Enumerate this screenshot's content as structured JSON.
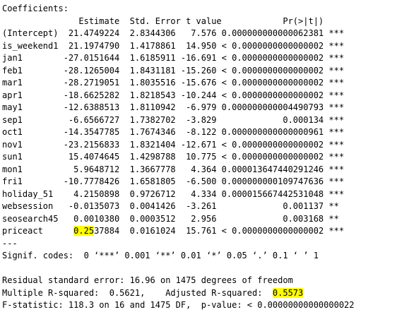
{
  "coefficients": {
    "heading": "Coefficients:",
    "header_line": "               Estimate  Std. Error t value            Pr(>|t|)    ",
    "rows": [
      {
        "pre": "(Intercept)  21.4749224  2.8344306   7.576 0.000000000000062381 ***"
      },
      {
        "pre": "is_weekend1  21.1974790  1.4178861  14.950 < 0.0000000000000002 ***"
      },
      {
        "pre": "jan1        -27.0151644  1.6185911 -16.691 < 0.0000000000000002 ***"
      },
      {
        "pre": "feb1        -28.1265004  1.8431181 -15.260 < 0.0000000000000002 ***"
      },
      {
        "pre": "mar1        -28.2719051  1.8035516 -15.676 < 0.0000000000000002 ***"
      },
      {
        "pre": "apr1        -18.6625282  1.8218543 -10.244 < 0.0000000000000002 ***"
      },
      {
        "pre": "may1        -12.6388513  1.8110942  -6.979 0.000000000004490793 ***"
      },
      {
        "pre": "sep1         -6.6566727  1.7382702  -3.829             0.000134 ***"
      },
      {
        "pre": "oct1        -14.3547785  1.7674346  -8.122 0.000000000000000961 ***"
      },
      {
        "pre": "nov1        -23.2156833  1.8321404 -12.671 < 0.0000000000000002 ***"
      },
      {
        "pre": "sun1         15.4074645  1.4298788  10.775 < 0.0000000000000002 ***"
      },
      {
        "pre": "mon1          5.9648712  1.3667778   4.364 0.00001364744029124­6 ***"
      },
      {
        "pre": "fri1        -10.7778426  1.6581805  -6.500 0.000000000109747636 ***"
      },
      {
        "pre": "holiday_51    4.2150898  0.9726712   4.334 0.000015667442531048 ***"
      },
      {
        "pre": "websession   -0.0135073  0.0041426  -3.261             0.001137 ** "
      },
      {
        "pre": "seosearch45   0.0010380  0.0003512   2.956             0.003168 ** "
      },
      {
        "pre": "priceact      ",
        "hl": "0.25",
        "post": "37884  0.0161024  15.761 < 0.0000000000000002 ***"
      }
    ],
    "separator": "---"
  },
  "signif": "Signif. codes:  0 ‘***’ 0.001 ‘**’ 0.01 ‘*’ 0.05 ‘.’ 0.1 ‘ ’ 1",
  "summary": {
    "rse": "Residual standard error: 16.96 on 1475 degrees of freedom",
    "r2_pre": "Multiple R-squared:  0.5621,\tAdjusted R-squared:  ",
    "r2_hl": "0.5573",
    "fstat": "F-statistic: 118.3 on 16 and 1475 DF,  p-value: < 0.00000000000000022"
  },
  "colors": {
    "highlight": "#ffff00",
    "text": "#000000",
    "background": "#ffffff"
  }
}
